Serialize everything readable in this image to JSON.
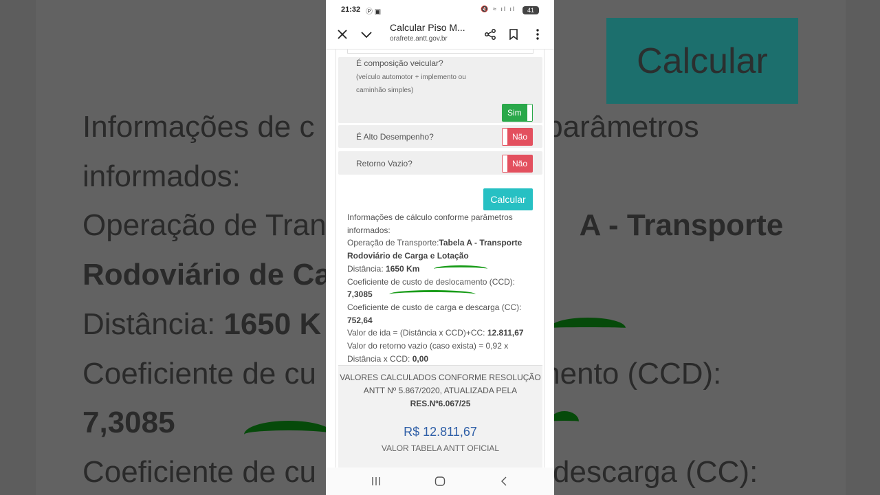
{
  "background": {
    "button_label": "Calcular",
    "lines": [
      {
        "text": "Informações de c",
        "bold": "",
        "tail": "e parâmetros"
      },
      {
        "text": "informados:",
        "bold": "",
        "tail": ""
      },
      {
        "text": "Operação de Tran",
        "bold": "",
        "tail": "A - Transporte"
      },
      {
        "text": "",
        "bold": "Rodoviário de Ca",
        "tail": ""
      },
      {
        "text": "Distância: ",
        "bold": "1650 K",
        "tail": ""
      },
      {
        "text": "Coeficiente de cu",
        "bold": "",
        "tail": "mento (CCD):"
      },
      {
        "text": "",
        "bold": "7,3085",
        "tail": ""
      },
      {
        "text": "Coeficiente de cu",
        "bold": "",
        "tail": "descarga (CC):"
      }
    ]
  },
  "status_bar": {
    "time": "21:32",
    "battery": "41"
  },
  "browser": {
    "title": "Calcular Piso M...",
    "url": "pisominimodefrete.antt.gov.br",
    "url_visible": "orafrete.antt.gov.br",
    "close_icon": "close-icon",
    "collapse_icon": "chevron-down-icon",
    "share_icon": "share-icon",
    "bookmark_icon": "bookmark-icon",
    "menu_icon": "more-vert-icon"
  },
  "form": {
    "composicao": {
      "question": "É composição veicular?",
      "hint_line1": "(veículo automotor + implemento ou",
      "hint_line2": "caminhão simples)",
      "toggle_label": "Sim",
      "toggle_state": "on"
    },
    "alto_desempenho": {
      "question": "É Alto Desempenho?",
      "toggle_label": "Não",
      "toggle_state": "off"
    },
    "retorno_vazio": {
      "question": "Retorno Vazio?",
      "toggle_label": "Não",
      "toggle_state": "off"
    },
    "calculate_label": "Calcular"
  },
  "info": {
    "heading1": "Informações de cálculo conforme parâmetros",
    "heading2": "informados:",
    "operation_label": "Operação de Transporte:",
    "operation_value1": "Tabela A - Transporte",
    "operation_value2": "Rodoviário de Carga e Lotação",
    "distance_label": "Distância: ",
    "distance_value": "1650 Km",
    "ccd_label": "Coeficiente de custo de deslocamento (CCD):",
    "ccd_value": "7,3085",
    "cc_label": "Coeficiente de custo de carga e descarga (CC):",
    "cc_value": "752,64",
    "ida_label": "Valor de ida = (Distância x CCD)+CC: ",
    "ida_value": "12.811,67",
    "retorno_label1": "Valor do retorno vazio (caso exista) = 0,92 x",
    "retorno_label2": "Distância x CCD: ",
    "retorno_value": "0,00"
  },
  "result": {
    "line1": "VALORES CALCULADOS CONFORME RESOLUÇÃO",
    "line2": "ANTT Nº 5.867/2020, ATUALIZADA PELA",
    "line3": "RES.Nº6.067/25",
    "value": "R$ 12.811,67",
    "caption": "VALOR TABELA ANTT OFICIAL"
  },
  "nav": {
    "recents_icon": "recents-icon",
    "home_icon": "home-icon",
    "back_icon": "back-icon"
  },
  "colors": {
    "toggle_on": "#2aa84a",
    "toggle_off": "#e3505e",
    "calculate_button": "#27c0c3",
    "result_value": "#2f5fa7",
    "annotation_marker": "#1a9c1a"
  }
}
